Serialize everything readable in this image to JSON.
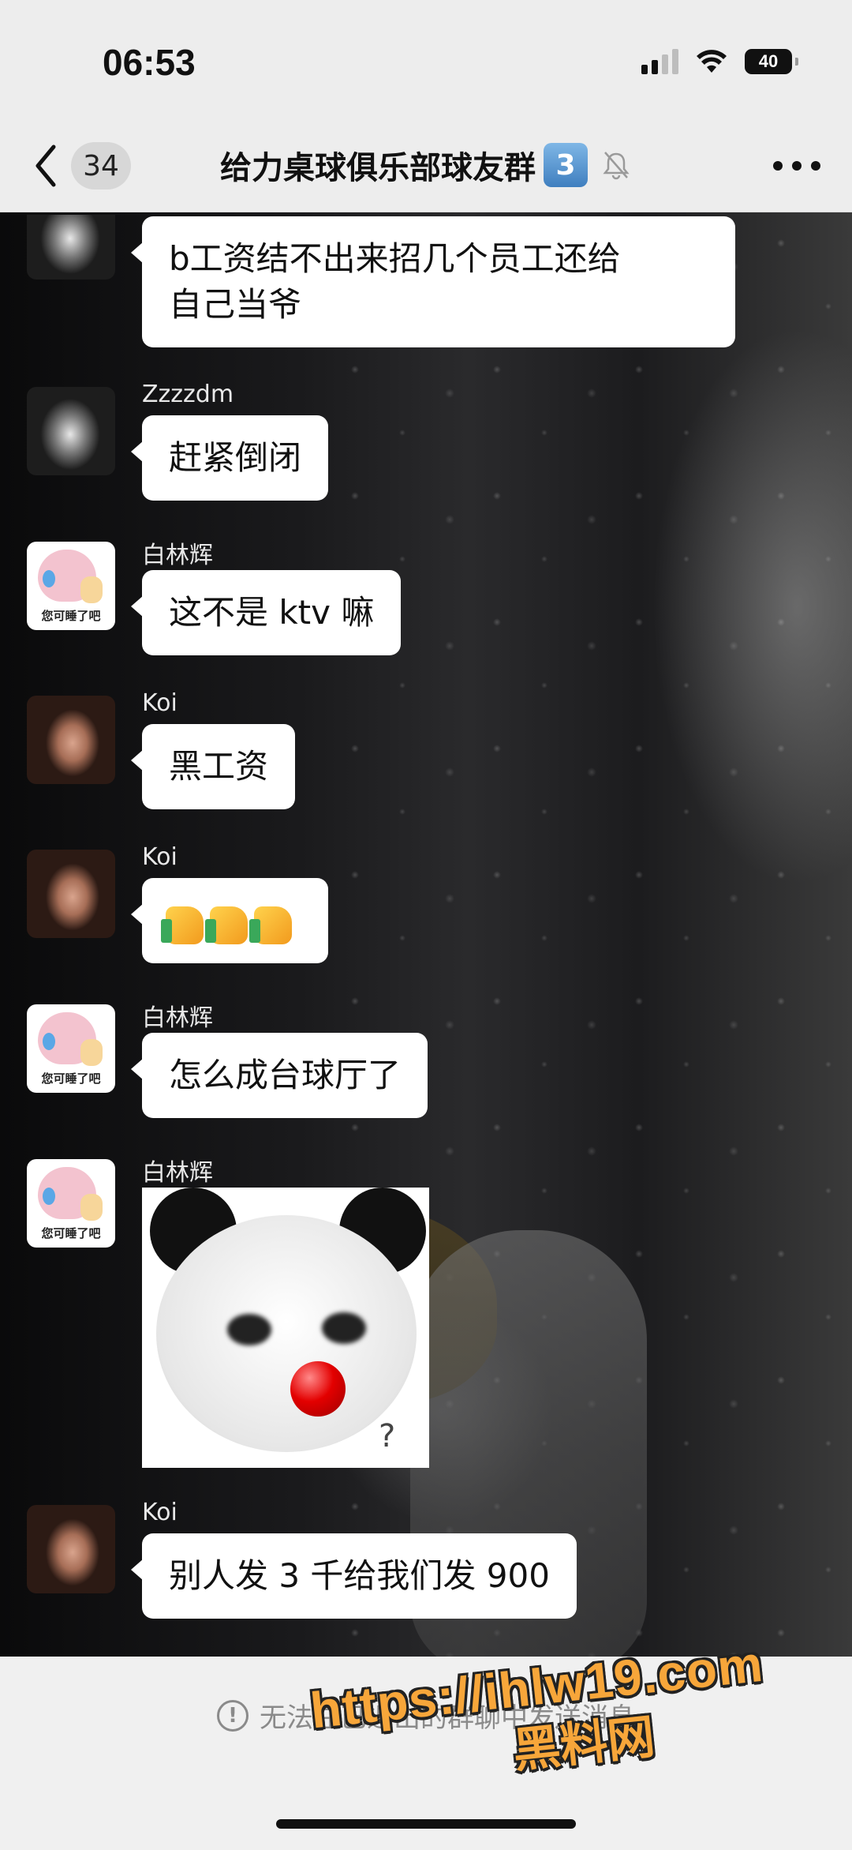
{
  "status_bar": {
    "time": "06:53",
    "battery": "40"
  },
  "header": {
    "unread_count": "34",
    "group_name": "给力桌球俱乐部球友群",
    "member_badge": "3"
  },
  "messages": [
    {
      "sender": "",
      "text_lines": [
        "b工资结不出来招几个员工还给",
        "自己当爷"
      ]
    },
    {
      "sender": "Zzzzdm",
      "text": "赶紧倒闭"
    },
    {
      "sender": "白林辉",
      "text": "这不是 ktv 嘛",
      "avatar_caption": "您可睡了吧"
    },
    {
      "sender": "Koi",
      "text": "黑工资"
    },
    {
      "sender": "Koi",
      "emoji": "thumbs-up x3"
    },
    {
      "sender": "白林辉",
      "text": "怎么成台球厅了",
      "avatar_caption": "您可睡了吧"
    },
    {
      "sender": "白林辉",
      "sticker": "panda-red-nose",
      "sticker_text": "?",
      "avatar_caption": "您可睡了吧"
    },
    {
      "sender": "Koi",
      "text": "别人发 3 千给我们发 900"
    }
  ],
  "footer": {
    "notice_icon": "!",
    "notice": "无法在已退出的群聊中发送消息"
  },
  "watermark": {
    "url": "https://ihlw19.com",
    "name": "黑料网"
  },
  "colors": {
    "bubble": "#ffffff",
    "header_bg": "#ededed",
    "watermark": "#f7a63a"
  }
}
